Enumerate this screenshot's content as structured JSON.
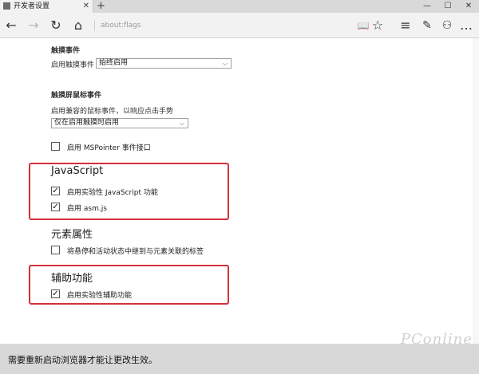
{
  "tab": {
    "title": "开发者设置",
    "close": "✕"
  },
  "new_tab": "+",
  "window": {
    "minimize": "—",
    "maximize": "☐",
    "close": "✕"
  },
  "nav": {
    "back": "←",
    "forward": "→",
    "refresh": "↻",
    "home": "⌂",
    "address": "about:flags",
    "reading_view": "📖",
    "favorite": "☆",
    "hub": "≡",
    "notes": "✎",
    "share": "⚇",
    "more": "…"
  },
  "touch_events": {
    "heading": "触摸事件",
    "label": "启用触摸事件",
    "value": "始终启用"
  },
  "touch_mouse": {
    "heading": "触摸屏鼠标事件",
    "label": "启用兼容的鼠标事件，以响应点击手势",
    "value": "仅在启用触摸时启用"
  },
  "mspointer": {
    "checked": false,
    "label": "启用 MSPointer 事件接口"
  },
  "javascript": {
    "heading": "JavaScript",
    "options": [
      {
        "checked": true,
        "label": "启用实验性 JavaScript 功能"
      },
      {
        "checked": true,
        "label": "启用 asm.js"
      }
    ]
  },
  "element_props": {
    "heading": "元素属性",
    "option": {
      "checked": false,
      "label": "将悬停和活动状态中继到与元素关联的标签"
    }
  },
  "accessibility": {
    "heading": "辅助功能",
    "option": {
      "checked": true,
      "label": "启用实验性辅助功能"
    }
  },
  "checkmark": "✓",
  "chevron": "⌵",
  "notice": "需要重新启动浏览器才能让更改生效。",
  "watermark": "PConline",
  "colors": {
    "highlight": "#d3313b",
    "notice_bg": "#d8d8d8",
    "chrome_bg": "#f2f2f2"
  }
}
